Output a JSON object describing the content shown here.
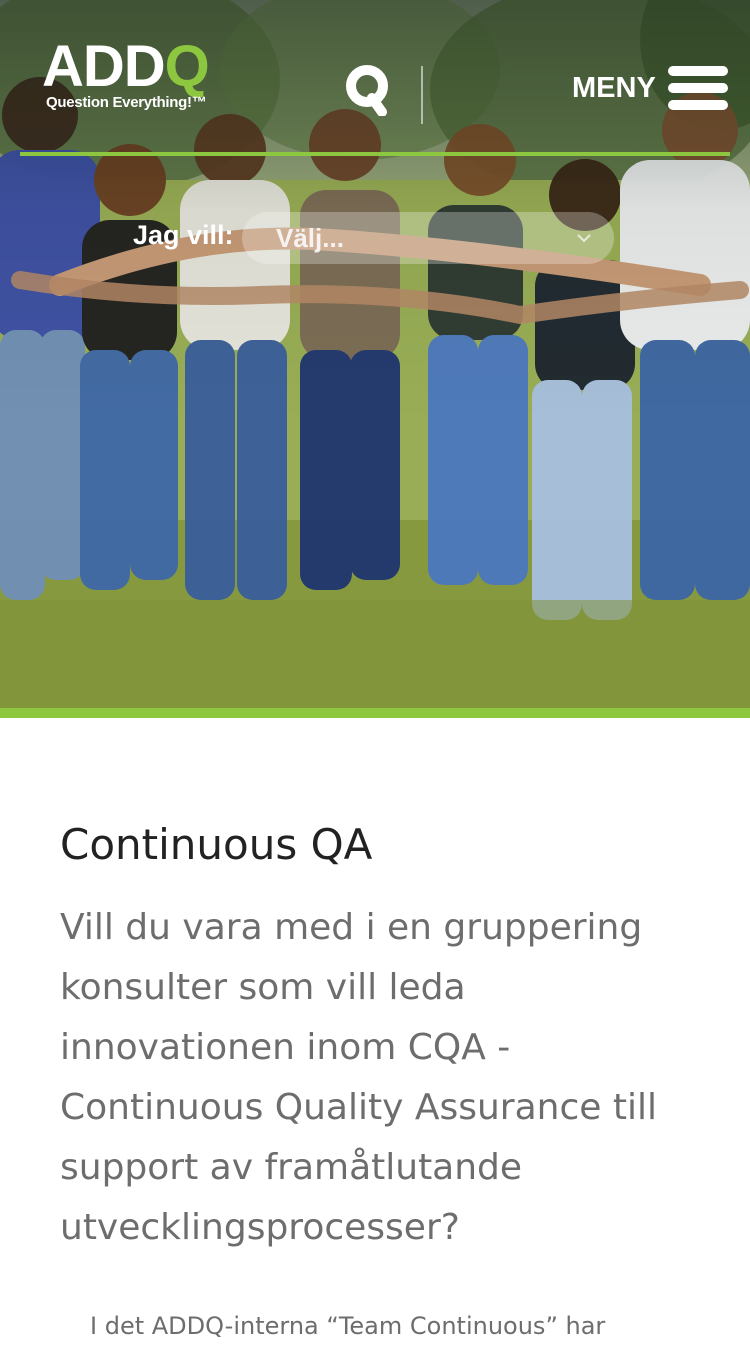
{
  "header": {
    "logo_text": "ADDQ",
    "logo_main": "ADD",
    "logo_accent": "Q",
    "tagline": "Question Everything!",
    "tagline_mark": "™",
    "search_icon": "search-q-icon",
    "menu_label": "MENY",
    "menu_icon": "hamburger-icon"
  },
  "selector": {
    "label": "Jag vill:",
    "value": "Välj..."
  },
  "content": {
    "title": "Continuous QA",
    "lead": "Vill du vara med i en gruppering konsulter som vill leda innovationen inom CQA - Continuous Quality Assurance till support av framåtlutande utvecklingsprocesser?",
    "body_start": "I det ADDQ-interna “Team Continuous” har"
  },
  "colors": {
    "brand_green": "#8dc63f",
    "text_dark": "#222222",
    "text_gray": "#6d6d6d"
  }
}
